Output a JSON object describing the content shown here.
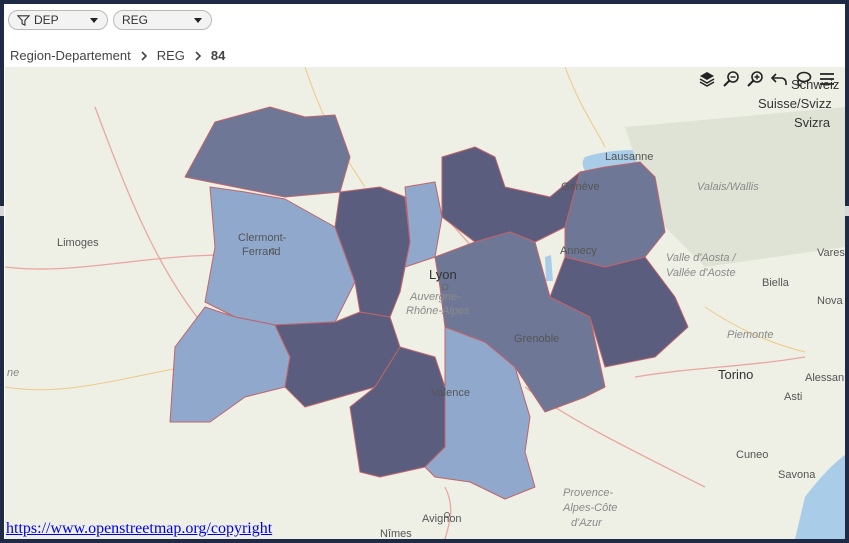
{
  "filters": {
    "dep_label": "DEP",
    "reg_label": "REG"
  },
  "breadcrumb": {
    "root": "Region-Departement",
    "level": "REG",
    "current": "84"
  },
  "map": {
    "places": {
      "schweiz": "Schweiz",
      "suisse": "Suisse/Svizz",
      "svizra": "Svizra",
      "lausanne": "Lausanne",
      "geneve": "Genève",
      "valais": "Valais/Wallis",
      "limoges": "Limoges",
      "clermont1": "Clermont-",
      "clermont2": "Ferrand",
      "annecy": "Annecy",
      "valle1": "Valle d'Aosta /",
      "valle2": "Vallée d'Aoste",
      "vares": "Vares",
      "lyon": "Lyon",
      "region1": "Auvergne-",
      "region2": "Rhône-Alpes",
      "biella": "Biella",
      "novara": "Nova",
      "grenoble": "Grenoble",
      "piemonte": "Piemonte",
      "ne": "ne",
      "torino": "Torino",
      "alessan": "Alessan",
      "asti": "Asti",
      "valence": "Valence",
      "cuneo": "Cuneo",
      "savona": "Savona",
      "provence1": "Provence-",
      "provence2": "Alpes-Côte",
      "provence3": "d'Azur",
      "avignon": "Avignon",
      "nimes": "Nîmes"
    },
    "colors": {
      "region_dark": "#5a5d7e",
      "region_mid": "#6f7796",
      "region_light": "#8fa8cc",
      "border": "#c0646a",
      "land": "#eef0e6",
      "water": "#a9cde8"
    }
  },
  "attribution": "https://www.openstreetmap.org/copyright",
  "toolbar_icons": [
    "layers-icon",
    "zoom-out-icon",
    "zoom-in-icon",
    "undo-icon",
    "lasso-icon",
    "menu-icon"
  ]
}
